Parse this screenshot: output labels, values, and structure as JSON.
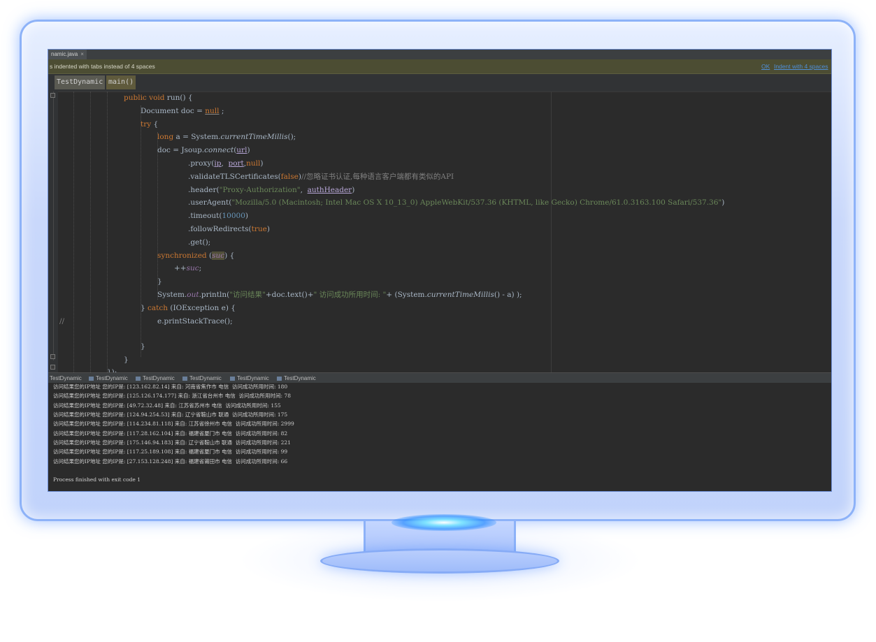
{
  "file_tab": {
    "label": "namic.java",
    "close": "×"
  },
  "notice": {
    "text": "s indented with tabs instead of 4 spaces",
    "ok": "OK",
    "indent": "Indent with 4 spaces"
  },
  "breadcrumbs": [
    "TestDynamic",
    "main()"
  ],
  "code": {
    "l1_kw": "public void",
    "l1_rest": " run() {",
    "l2_a": "Document doc = ",
    "l2_null": "null",
    "l2_b": " ;",
    "l3_kw": "try",
    "l3_b": " {",
    "l4_kw": "long",
    "l4_a": " a = System.",
    "l4_m": "currentTimeMillis",
    "l4_b": "();",
    "l5_a": "doc = Jsoup.",
    "l5_m": "connect",
    "l5_p": "(",
    "l5_url": "url",
    "l5_c": ")",
    "l6_a": ".proxy(",
    "l6_ip": "ip",
    "l6_comma": ",  ",
    "l6_port": "port",
    "l6_comma2": ",",
    "l6_null": "null",
    "l6_c": ")",
    "l7_a": ".validateTLSCertificates(",
    "l7_false": "false",
    "l7_c": ")",
    "l7_cmt": "//忽略证书认证,每种语言客户端都有类似的API",
    "l8_a": ".header(",
    "l8_str": "\"Proxy-Authorization\"",
    "l8_comma": ",  ",
    "l8_auth": "authHeader",
    "l8_c": ")",
    "l9_a": ".userAgent(",
    "l9_str": "\"Mozilla/5.0 (Macintosh; Intel Mac OS X 10_13_0) AppleWebKit/537.36 (KHTML, like Gecko) Chrome/61.0.3163.100 Safari/537.36\"",
    "l9_c": ")",
    "l10_a": ".timeout(",
    "l10_num": "10000",
    "l10_c": ")",
    "l11_a": ".followRedirects(",
    "l11_true": "true",
    "l11_c": ")",
    "l12_a": ".get();",
    "l13_kw": "synchronized",
    "l13_a": " (",
    "l13_suc": "suc",
    "l13_c": ") {",
    "l14_a": "++",
    "l14_suc": "suc",
    "l14_b": ";",
    "l15": "}",
    "l16_a": "System.",
    "l16_out": "out",
    "l16_b": ".println(",
    "l16_s1": "\"访问结果\"",
    "l16_c": "+doc.text()+",
    "l16_s2": "\" 访问成功所用时间: \"",
    "l16_d": "+ (System.",
    "l16_m": "currentTimeMillis",
    "l16_e": "() - a) );",
    "l17_a": "} ",
    "l17_kw": "catch",
    "l17_b": " (IOException e) {",
    "l18_cmt": "//",
    "l18_a": "e.printStackTrace();",
    "l19": "}",
    "l20": "}",
    "l21": "});"
  },
  "run_tabs": [
    "TestDynamic",
    "TestDynamic",
    "TestDynamic",
    "TestDynamic",
    "TestDynamic",
    "TestDynamic"
  ],
  "console_lines": [
    "访问结果您的IP地址 您的IP是: [123.162.82.14] 来自: 河南省焦作市 电信  访问成功所用时间: 180",
    "访问结果您的IP地址 您的IP是: [125.126.174.177] 来自: 浙江省台州市 电信  访问成功所用时间: 78",
    "访问结果您的IP地址 您的IP是: [49.72.32.48] 来自: 江苏省苏州市 电信  访问成功所用时间: 155",
    "访问结果您的IP地址 您的IP是: [124.94.254.53] 来自: 辽宁省鞍山市 联通  访问成功所用时间: 175",
    "访问结果您的IP地址 您的IP是: [114.234.81.118] 来自: 江苏省徐州市 电信  访问成功所用时间: 2999",
    "访问结果您的IP地址 您的IP是: [117.28.162.104] 来自: 福建省厦门市 电信  访问成功所用时间: 82",
    "访问结果您的IP地址 您的IP是: [175.146.94.183] 来自: 辽宁省鞍山市 联通  访问成功所用时间: 221",
    "访问结果您的IP地址 您的IP是: [117.25.189.108] 来自: 福建省厦门市 电信  访问成功所用时间: 99",
    "访问结果您的IP地址 您的IP是: [27.153.128.248] 来自: 福建省莆田市 电信  访问成功所用时间: 66",
    "",
    "Process finished with exit code 1"
  ]
}
